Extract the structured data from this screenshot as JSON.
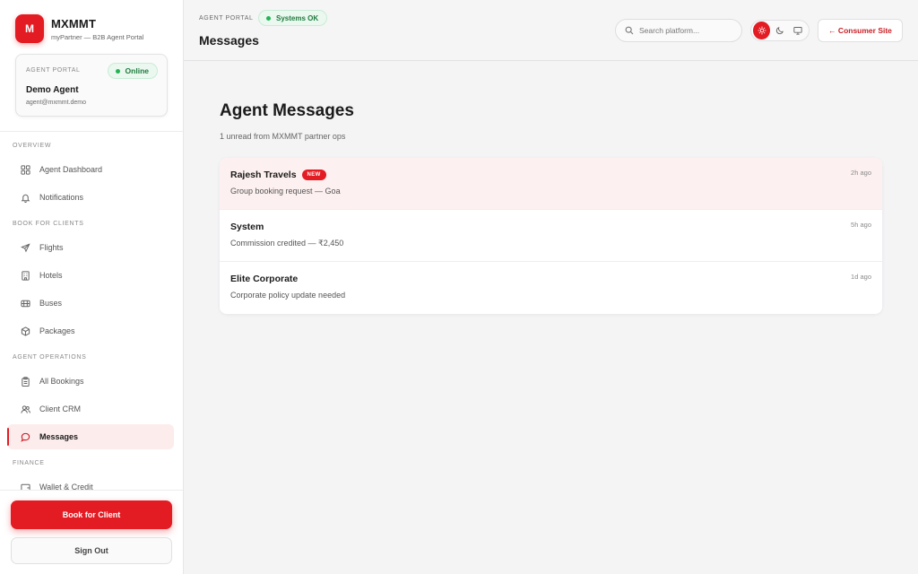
{
  "brand": {
    "logo_letter": "M",
    "name": "MXMMT",
    "subtitle": "myPartner — B2B Agent Portal"
  },
  "agent_card": {
    "label": "AGENT PORTAL",
    "status": "Online",
    "name": "Demo Agent",
    "email": "agent@mxmmt.demo"
  },
  "nav": {
    "sections": [
      {
        "title": "OVERVIEW",
        "items": [
          {
            "label": "Agent Dashboard",
            "icon": "dashboard-icon"
          },
          {
            "label": "Notifications",
            "icon": "bell-icon"
          }
        ]
      },
      {
        "title": "BOOK FOR CLIENTS",
        "items": [
          {
            "label": "Flights",
            "icon": "plane-icon"
          },
          {
            "label": "Hotels",
            "icon": "building-icon"
          },
          {
            "label": "Buses",
            "icon": "bus-icon"
          },
          {
            "label": "Packages",
            "icon": "package-icon"
          }
        ]
      },
      {
        "title": "AGENT OPERATIONS",
        "items": [
          {
            "label": "All Bookings",
            "icon": "clipboard-icon"
          },
          {
            "label": "Client CRM",
            "icon": "users-icon"
          },
          {
            "label": "Messages",
            "icon": "message-icon",
            "active": true
          }
        ]
      },
      {
        "title": "FINANCE",
        "items": [
          {
            "label": "Wallet & Credit",
            "icon": "wallet-icon"
          }
        ]
      }
    ]
  },
  "sidebar_actions": {
    "book_label": "Book for Client",
    "signout_label": "Sign Out"
  },
  "header": {
    "portal_label": "AGENT PORTAL",
    "system_status": "Systems OK",
    "page_title": "Messages",
    "search_placeholder": "Search platform...",
    "theme_options": [
      "light",
      "dark",
      "system"
    ],
    "theme_selected": "light",
    "consumer_link": "← Consumer Site"
  },
  "main": {
    "title": "Agent Messages",
    "subtitle": "1 unread from MXMMT partner ops",
    "messages": [
      {
        "sender": "Rajesh Travels",
        "badge": "NEW",
        "preview": "Group booking request — Goa",
        "time": "2h ago",
        "unread": true
      },
      {
        "sender": "System",
        "badge": "",
        "preview": "Commission credited — ₹2,450",
        "time": "5h ago",
        "unread": false
      },
      {
        "sender": "Elite Corporate",
        "badge": "",
        "preview": "Corporate policy update needed",
        "time": "1d ago",
        "unread": false
      }
    ]
  },
  "colors": {
    "accent": "#e31b23",
    "success": "#22b455",
    "unread_bg": "#fdf0f0"
  }
}
